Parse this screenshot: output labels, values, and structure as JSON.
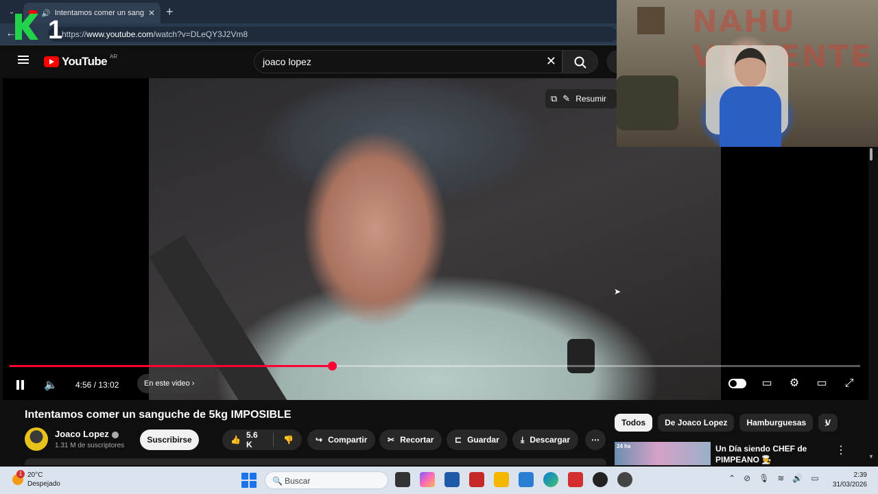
{
  "browser": {
    "tab_title": "Intentamos comer un sanguc",
    "tab_close": "✕",
    "new_tab": "+",
    "url_host": "www.youtube.com",
    "url_prefix": "https://",
    "url_path": "/watch?v=DLeQY3J2Vm8"
  },
  "youtube": {
    "logo_text": "YouTube",
    "country": "AR",
    "search_query": "joaco lopez",
    "summarize_label": "Resumir",
    "player": {
      "current_time": "4:56",
      "duration": "13:02",
      "time_display": "4:56 / 13:02",
      "progress": 0.379,
      "chapter_label": "En este video"
    },
    "video_title": "Intentamos comer un sanguche de 5kg IMPOSIBLE",
    "channel": {
      "name": "Joaco Lopez",
      "subscribers": "1.31 M de suscriptores",
      "subscribe_label": "Suscribirse"
    },
    "actions": {
      "likes": "5.6 K",
      "share": "Compartir",
      "clip": "Recortar",
      "save": "Guardar",
      "download": "Descargar"
    },
    "chips": [
      "Todos",
      "De Joaco Lopez",
      "Hamburguesas",
      "V"
    ],
    "recommended": {
      "title": "Un Día siendo CHEF de PIMPEANO 🧑‍🍳",
      "badge": "24 hs"
    }
  },
  "webcam": {
    "graffiti_text": "NAHU VINCENTE"
  },
  "taskbar": {
    "temperature": "20°C",
    "weather": "Despejado",
    "weather_badge": "1",
    "search_placeholder": "Buscar",
    "time": "2:39",
    "date": "31/03/2026"
  },
  "overlay": {
    "logo_text": "1"
  },
  "colors": {
    "accent": "#ff0033",
    "youtube_red": "#ff0000",
    "background": "#0f0f0f"
  }
}
